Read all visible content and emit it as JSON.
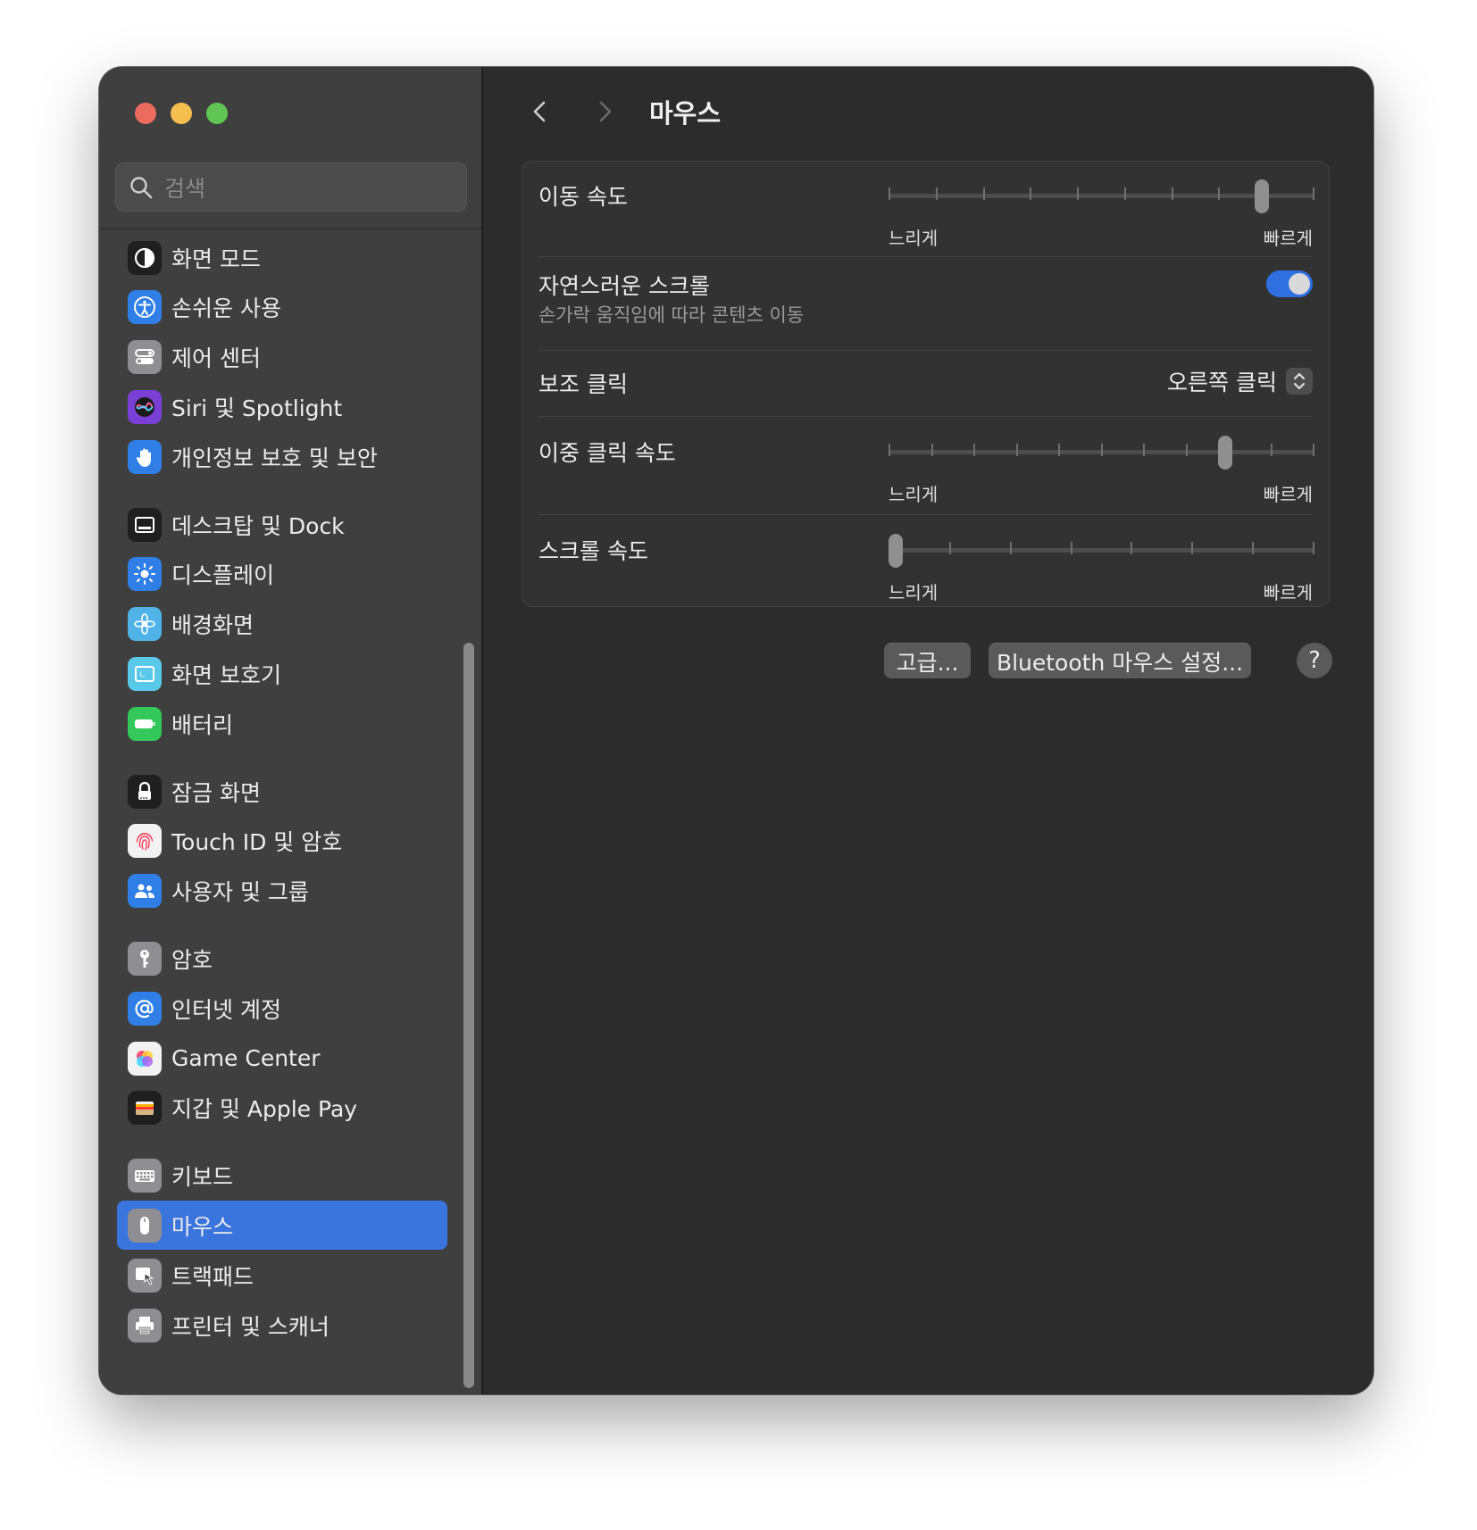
{
  "window": {
    "title": "마우스"
  },
  "search": {
    "placeholder": "검색"
  },
  "sidebar": {
    "items": [
      {
        "label": "화면 모드",
        "icon": "appearance-icon",
        "color": "#1f1f1f"
      },
      {
        "label": "손쉬운 사용",
        "icon": "accessibility-icon",
        "color": "#2f7fe6"
      },
      {
        "label": "제어 센터",
        "icon": "control-center-icon",
        "color": "#8e8e93"
      },
      {
        "label": "Siri 및 Spotlight",
        "icon": "siri-icon",
        "color": "#7a3fd6"
      },
      {
        "label": "개인정보 보호 및 보안",
        "icon": "hand-icon",
        "color": "#2f7fe6"
      },
      {
        "label": "데스크탑 및 Dock",
        "icon": "dock-icon",
        "color": "#1f1f1f"
      },
      {
        "label": "디스플레이",
        "icon": "display-icon",
        "color": "#2f7fe6"
      },
      {
        "label": "배경화면",
        "icon": "wallpaper-icon",
        "color": "#4fb3e8"
      },
      {
        "label": "화면 보호기",
        "icon": "screensaver-icon",
        "color": "#5ac8e8"
      },
      {
        "label": "배터리",
        "icon": "battery-icon",
        "color": "#34c759"
      },
      {
        "label": "잠금 화면",
        "icon": "lock-icon",
        "color": "#1f1f1f"
      },
      {
        "label": "Touch ID 및 암호",
        "icon": "fingerprint-icon",
        "color": "#f2f2f2"
      },
      {
        "label": "사용자 및 그룹",
        "icon": "users-icon",
        "color": "#2f7fe6"
      },
      {
        "label": "암호",
        "icon": "key-icon",
        "color": "#8e8e93"
      },
      {
        "label": "인터넷 계정",
        "icon": "at-icon",
        "color": "#2f7fe6"
      },
      {
        "label": "Game Center",
        "icon": "game-center-icon",
        "color": "#f2f2f2"
      },
      {
        "label": "지갑 및 Apple Pay",
        "icon": "wallet-icon",
        "color": "#1f1f1f"
      },
      {
        "label": "키보드",
        "icon": "keyboard-icon",
        "color": "#8e8e93"
      },
      {
        "label": "마우스",
        "icon": "mouse-icon",
        "color": "#8e8e93",
        "selected": true
      },
      {
        "label": "트랙패드",
        "icon": "trackpad-icon",
        "color": "#8e8e93"
      },
      {
        "label": "프린터 및 스캐너",
        "icon": "printer-icon",
        "color": "#8e8e93"
      }
    ]
  },
  "settings": {
    "tracking_speed": {
      "label": "이동 속도",
      "min_label": "느리게",
      "max_label": "빠르게",
      "ticks": 10,
      "value": 0.89
    },
    "natural_scroll": {
      "label": "자연스러운 스크롤",
      "description": "손가락 움직임에 따라 콘텐츠 이동",
      "enabled": true
    },
    "secondary_click": {
      "label": "보조 클릭",
      "value": "오른쪽 클릭"
    },
    "double_click_speed": {
      "label": "이중 클릭 속도",
      "min_label": "느리게",
      "max_label": "빠르게",
      "ticks": 11,
      "value": 0.8
    },
    "scroll_speed": {
      "label": "스크롤 속도",
      "min_label": "느리게",
      "max_label": "빠르게",
      "ticks": 8,
      "value": 0.0
    }
  },
  "buttons": {
    "advanced": "고급...",
    "bluetooth": "Bluetooth 마우스 설정...",
    "help": "?"
  },
  "colors": {
    "accent": "#3a74dd",
    "toggle_on": "#2f6fe0"
  }
}
